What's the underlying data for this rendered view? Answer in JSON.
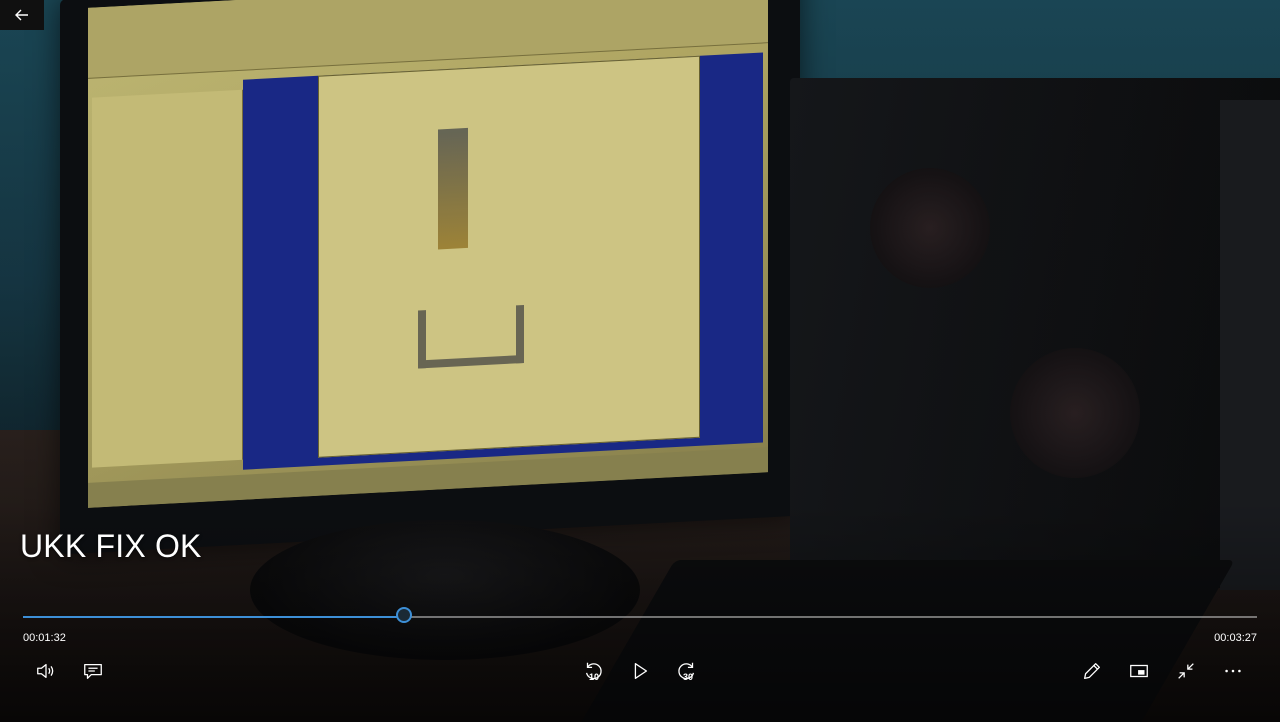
{
  "video": {
    "title": "UKK FIX OK",
    "current_time": "00:01:32",
    "total_time": "00:03:27",
    "progress": 0.309
  },
  "controls": {
    "skip_back_seconds": "10",
    "skip_forward_seconds": "30"
  },
  "colors": {
    "accent": "#3d8fd6",
    "text": "#ffffff"
  },
  "icons": {
    "back": "arrow-left-icon",
    "volume": "volume-icon",
    "subtitles": "subtitles-icon",
    "skip_back": "skip-back-10-icon",
    "play": "play-icon",
    "skip_forward": "skip-forward-30-icon",
    "edit": "pencil-icon",
    "mini_view": "mini-view-icon",
    "exit_fullscreen": "exit-fullscreen-icon",
    "more": "more-options-icon"
  }
}
